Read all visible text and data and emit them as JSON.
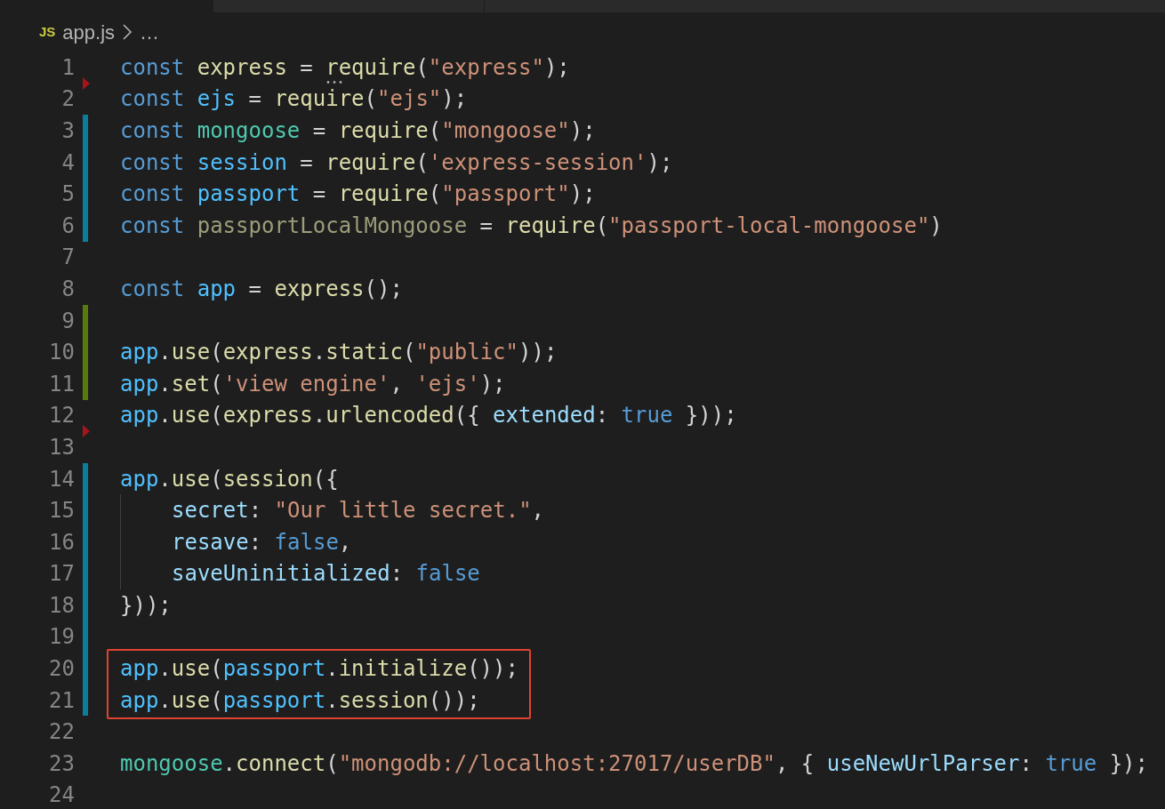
{
  "breadcrumb": {
    "file_badge": "JS",
    "file": "app.js",
    "more": "…"
  },
  "lines": [
    {
      "number": "1",
      "modified": false,
      "added": false,
      "deleted_before": false,
      "indent_guide": false,
      "boxed": false,
      "tokens": [
        {
          "kind": "keyword",
          "text": "const "
        },
        {
          "kind": "function",
          "text": "express"
        },
        {
          "kind": "plain",
          "text": " = "
        },
        {
          "kind": "function",
          "text": "require",
          "hint": true
        },
        {
          "kind": "plain",
          "text": "("
        },
        {
          "kind": "string",
          "text": "\"express\""
        },
        {
          "kind": "plain",
          "text": ");"
        }
      ]
    },
    {
      "number": "2",
      "modified": false,
      "added": false,
      "deleted_before": true,
      "indent_guide": false,
      "boxed": false,
      "tokens": [
        {
          "kind": "keyword",
          "text": "const "
        },
        {
          "kind": "variable",
          "text": "ejs"
        },
        {
          "kind": "plain",
          "text": " = "
        },
        {
          "kind": "function",
          "text": "require"
        },
        {
          "kind": "plain",
          "text": "("
        },
        {
          "kind": "string",
          "text": "\"ejs\""
        },
        {
          "kind": "plain",
          "text": ");"
        }
      ]
    },
    {
      "number": "3",
      "modified": true,
      "added": false,
      "deleted_before": false,
      "indent_guide": false,
      "boxed": false,
      "tokens": [
        {
          "kind": "keyword",
          "text": "const "
        },
        {
          "kind": "module",
          "text": "mongoose"
        },
        {
          "kind": "plain",
          "text": " = "
        },
        {
          "kind": "function",
          "text": "require"
        },
        {
          "kind": "plain",
          "text": "("
        },
        {
          "kind": "string",
          "text": "\"mongoose\""
        },
        {
          "kind": "plain",
          "text": ");"
        }
      ]
    },
    {
      "number": "4",
      "modified": true,
      "added": false,
      "deleted_before": false,
      "indent_guide": false,
      "boxed": false,
      "tokens": [
        {
          "kind": "keyword",
          "text": "const "
        },
        {
          "kind": "variable",
          "text": "session"
        },
        {
          "kind": "plain",
          "text": " = "
        },
        {
          "kind": "function",
          "text": "require"
        },
        {
          "kind": "plain",
          "text": "("
        },
        {
          "kind": "string",
          "text": "'express-session'"
        },
        {
          "kind": "plain",
          "text": ");"
        }
      ]
    },
    {
      "number": "5",
      "modified": true,
      "added": false,
      "deleted_before": false,
      "indent_guide": false,
      "boxed": false,
      "tokens": [
        {
          "kind": "keyword",
          "text": "const "
        },
        {
          "kind": "variable",
          "text": "passport"
        },
        {
          "kind": "plain",
          "text": " = "
        },
        {
          "kind": "function",
          "text": "require"
        },
        {
          "kind": "plain",
          "text": "("
        },
        {
          "kind": "string",
          "text": "\"passport\""
        },
        {
          "kind": "plain",
          "text": ");"
        }
      ]
    },
    {
      "number": "6",
      "modified": true,
      "added": false,
      "deleted_before": false,
      "indent_guide": false,
      "boxed": false,
      "tokens": [
        {
          "kind": "keyword",
          "text": "const "
        },
        {
          "kind": "unused",
          "text": "passportLocalMongoose"
        },
        {
          "kind": "plain",
          "text": " = "
        },
        {
          "kind": "function",
          "text": "require"
        },
        {
          "kind": "plain",
          "text": "("
        },
        {
          "kind": "string",
          "text": "\"passport-local-mongoose\""
        },
        {
          "kind": "plain",
          "text": ")"
        }
      ]
    },
    {
      "number": "7",
      "modified": false,
      "added": false,
      "deleted_before": false,
      "indent_guide": false,
      "boxed": false
    },
    {
      "number": "8",
      "modified": false,
      "added": false,
      "deleted_before": false,
      "indent_guide": false,
      "boxed": false,
      "tokens": [
        {
          "kind": "keyword",
          "text": "const "
        },
        {
          "kind": "variable",
          "text": "app"
        },
        {
          "kind": "plain",
          "text": " = "
        },
        {
          "kind": "function",
          "text": "express"
        },
        {
          "kind": "plain",
          "text": "();"
        }
      ]
    },
    {
      "number": "9",
      "modified": false,
      "added": true,
      "deleted_before": false,
      "indent_guide": false,
      "boxed": false
    },
    {
      "number": "10",
      "modified": false,
      "added": true,
      "deleted_before": false,
      "indent_guide": false,
      "boxed": false,
      "tokens": [
        {
          "kind": "variable",
          "text": "app"
        },
        {
          "kind": "plain",
          "text": "."
        },
        {
          "kind": "function",
          "text": "use"
        },
        {
          "kind": "plain",
          "text": "("
        },
        {
          "kind": "function",
          "text": "express"
        },
        {
          "kind": "plain",
          "text": "."
        },
        {
          "kind": "function",
          "text": "static"
        },
        {
          "kind": "plain",
          "text": "("
        },
        {
          "kind": "string",
          "text": "\"public\""
        },
        {
          "kind": "plain",
          "text": "));"
        }
      ]
    },
    {
      "number": "11",
      "modified": false,
      "added": true,
      "deleted_before": false,
      "indent_guide": false,
      "boxed": false,
      "tokens": [
        {
          "kind": "variable",
          "text": "app"
        },
        {
          "kind": "plain",
          "text": "."
        },
        {
          "kind": "function",
          "text": "set"
        },
        {
          "kind": "plain",
          "text": "("
        },
        {
          "kind": "string",
          "text": "'view engine'"
        },
        {
          "kind": "plain",
          "text": ", "
        },
        {
          "kind": "string",
          "text": "'ejs'"
        },
        {
          "kind": "plain",
          "text": ");"
        }
      ]
    },
    {
      "number": "12",
      "modified": false,
      "added": false,
      "deleted_before": false,
      "indent_guide": false,
      "boxed": false,
      "tokens": [
        {
          "kind": "variable",
          "text": "app"
        },
        {
          "kind": "plain",
          "text": "."
        },
        {
          "kind": "function",
          "text": "use"
        },
        {
          "kind": "plain",
          "text": "("
        },
        {
          "kind": "function",
          "text": "express"
        },
        {
          "kind": "plain",
          "text": "."
        },
        {
          "kind": "function",
          "text": "urlencoded"
        },
        {
          "kind": "plain",
          "text": "({ "
        },
        {
          "kind": "property",
          "text": "extended"
        },
        {
          "kind": "plain",
          "text": ": "
        },
        {
          "kind": "keyword",
          "text": "true"
        },
        {
          "kind": "plain",
          "text": " }));"
        }
      ]
    },
    {
      "number": "13",
      "modified": false,
      "added": false,
      "deleted_before": true,
      "indent_guide": false,
      "boxed": false
    },
    {
      "number": "14",
      "modified": true,
      "added": false,
      "deleted_before": false,
      "indent_guide": false,
      "boxed": false,
      "tokens": [
        {
          "kind": "variable",
          "text": "app"
        },
        {
          "kind": "plain",
          "text": "."
        },
        {
          "kind": "function",
          "text": "use"
        },
        {
          "kind": "plain",
          "text": "("
        },
        {
          "kind": "function",
          "text": "session"
        },
        {
          "kind": "plain",
          "text": "({"
        }
      ]
    },
    {
      "number": "15",
      "modified": true,
      "added": false,
      "deleted_before": false,
      "indent_guide": true,
      "boxed": false,
      "tokens": [
        {
          "kind": "property",
          "text": "secret"
        },
        {
          "kind": "plain",
          "text": ": "
        },
        {
          "kind": "string",
          "text": "\"Our little secret.\""
        },
        {
          "kind": "plain",
          "text": ","
        }
      ]
    },
    {
      "number": "16",
      "modified": true,
      "added": false,
      "deleted_before": false,
      "indent_guide": true,
      "boxed": false,
      "tokens": [
        {
          "kind": "property",
          "text": "resave"
        },
        {
          "kind": "plain",
          "text": ": "
        },
        {
          "kind": "keyword",
          "text": "false"
        },
        {
          "kind": "plain",
          "text": ","
        }
      ]
    },
    {
      "number": "17",
      "modified": true,
      "added": false,
      "deleted_before": false,
      "indent_guide": true,
      "boxed": false,
      "tokens": [
        {
          "kind": "property",
          "text": "saveUninitialized"
        },
        {
          "kind": "plain",
          "text": ": "
        },
        {
          "kind": "keyword",
          "text": "false"
        }
      ]
    },
    {
      "number": "18",
      "modified": true,
      "added": false,
      "deleted_before": false,
      "indent_guide": false,
      "boxed": false,
      "tokens": [
        {
          "kind": "plain",
          "text": "}));"
        }
      ]
    },
    {
      "number": "19",
      "modified": true,
      "added": false,
      "deleted_before": false,
      "indent_guide": false,
      "boxed": false
    },
    {
      "number": "20",
      "modified": true,
      "added": false,
      "deleted_before": false,
      "indent_guide": false,
      "boxed": true,
      "tokens": [
        {
          "kind": "variable",
          "text": "app"
        },
        {
          "kind": "plain",
          "text": "."
        },
        {
          "kind": "function",
          "text": "use"
        },
        {
          "kind": "plain",
          "text": "("
        },
        {
          "kind": "variable",
          "text": "passport"
        },
        {
          "kind": "plain",
          "text": "."
        },
        {
          "kind": "function",
          "text": "initialize"
        },
        {
          "kind": "plain",
          "text": "());"
        }
      ]
    },
    {
      "number": "21",
      "modified": true,
      "added": false,
      "deleted_before": false,
      "indent_guide": false,
      "boxed": true,
      "tokens": [
        {
          "kind": "variable",
          "text": "app"
        },
        {
          "kind": "plain",
          "text": "."
        },
        {
          "kind": "function",
          "text": "use"
        },
        {
          "kind": "plain",
          "text": "("
        },
        {
          "kind": "variable",
          "text": "passport"
        },
        {
          "kind": "plain",
          "text": "."
        },
        {
          "kind": "function",
          "text": "session"
        },
        {
          "kind": "plain",
          "text": "());"
        }
      ]
    },
    {
      "number": "22",
      "modified": false,
      "added": false,
      "deleted_before": false,
      "indent_guide": false,
      "boxed": false
    },
    {
      "number": "23",
      "modified": false,
      "added": false,
      "deleted_before": false,
      "indent_guide": false,
      "boxed": false,
      "tokens": [
        {
          "kind": "module",
          "text": "mongoose"
        },
        {
          "kind": "plain",
          "text": "."
        },
        {
          "kind": "function",
          "text": "connect"
        },
        {
          "kind": "plain",
          "text": "("
        },
        {
          "kind": "string",
          "text": "\"mongodb://localhost:27017/userDB\""
        },
        {
          "kind": "plain",
          "text": ", { "
        },
        {
          "kind": "property",
          "text": "useNewUrlParser"
        },
        {
          "kind": "plain",
          "text": ": "
        },
        {
          "kind": "keyword",
          "text": "true"
        },
        {
          "kind": "plain",
          "text": " });"
        }
      ]
    },
    {
      "number": "24",
      "modified": false,
      "added": false,
      "deleted_before": false,
      "indent_guide": false,
      "boxed": false
    }
  ]
}
